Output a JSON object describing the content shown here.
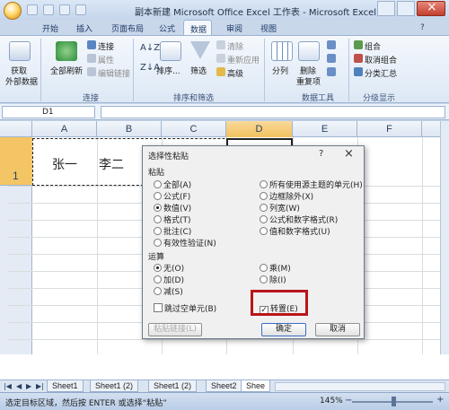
{
  "window": {
    "title": "副本新建 Microsoft Office Excel 工作表 - Microsoft Excel"
  },
  "ribbon": {
    "tabs": [
      {
        "label": "开始"
      },
      {
        "label": "插入"
      },
      {
        "label": "页面布局"
      },
      {
        "label": "公式"
      },
      {
        "label": "数据"
      },
      {
        "label": "审阅"
      },
      {
        "label": "视图"
      }
    ],
    "active_tab": "数据",
    "get_external": {
      "line1": "获取",
      "line2": "外部数据"
    },
    "connections": {
      "refresh_all_line1": "全部刷新",
      "connections": "连接",
      "properties": "属性",
      "edit_links": "编辑链接",
      "group_label": "连接"
    },
    "sort_filter": {
      "sort": "排序...",
      "filter": "筛选",
      "clear": "清除",
      "reapply": "重新应用",
      "advanced": "高级",
      "group_label": "排序和筛选"
    },
    "data_tools": {
      "split": "分列",
      "remove_dup_line1": "删除",
      "remove_dup_line2": "重复项",
      "group_label": "数据工具"
    },
    "outline": {
      "group": "组合",
      "ungroup": "取消组合",
      "subtotal": "分类汇总",
      "group_label": "分级显示"
    }
  },
  "formula_bar": {
    "name_box": "D1"
  },
  "sheet": {
    "columns": [
      "A",
      "B",
      "C",
      "D",
      "E",
      "F"
    ],
    "rows": [
      "1"
    ],
    "cells": {
      "A1": "张一",
      "B1": "李二"
    }
  },
  "dialog": {
    "title": "选择性粘贴",
    "help": "?",
    "close": "×",
    "paste_section": "粘贴",
    "paste_left": [
      {
        "label": "全部(A)",
        "selected": false
      },
      {
        "label": "公式(F)",
        "selected": false
      },
      {
        "label": "数值(V)",
        "selected": true
      },
      {
        "label": "格式(T)",
        "selected": false
      },
      {
        "label": "批注(C)",
        "selected": false
      },
      {
        "label": "有效性验证(N)",
        "selected": false
      }
    ],
    "paste_right": [
      {
        "label": "所有使用源主题的单元(H)",
        "selected": false
      },
      {
        "label": "边框除外(X)",
        "selected": false
      },
      {
        "label": "列宽(W)",
        "selected": false
      },
      {
        "label": "公式和数字格式(R)",
        "selected": false
      },
      {
        "label": "值和数字格式(U)",
        "selected": false
      }
    ],
    "operation_section": "运算",
    "op_left": [
      {
        "label": "无(O)",
        "selected": true
      },
      {
        "label": "加(D)",
        "selected": false
      },
      {
        "label": "减(S)",
        "selected": false
      }
    ],
    "op_right": [
      {
        "label": "乘(M)",
        "selected": false
      },
      {
        "label": "除(I)",
        "selected": false
      }
    ],
    "skip_blanks": {
      "label": "跳过空单元(B)",
      "checked": false
    },
    "transpose": {
      "label": "转置(E)",
      "checked": true
    },
    "paste_link_button": "粘贴链接(L)",
    "ok_button": "确定",
    "cancel_button": "取消"
  },
  "sheet_tabs": [
    "Sheet1",
    "Sheet1 (2)",
    "Sheet1 (2)",
    "Sheet2",
    "Shee"
  ],
  "status_bar": {
    "message": "选定目标区域，然后按 ENTER 或选择“粘贴”",
    "zoom": "145%"
  },
  "colors": {
    "highlight_box": "#b9141a",
    "selected_column_header": "#f1c15f",
    "ribbon_bg": "#dde8f5"
  }
}
